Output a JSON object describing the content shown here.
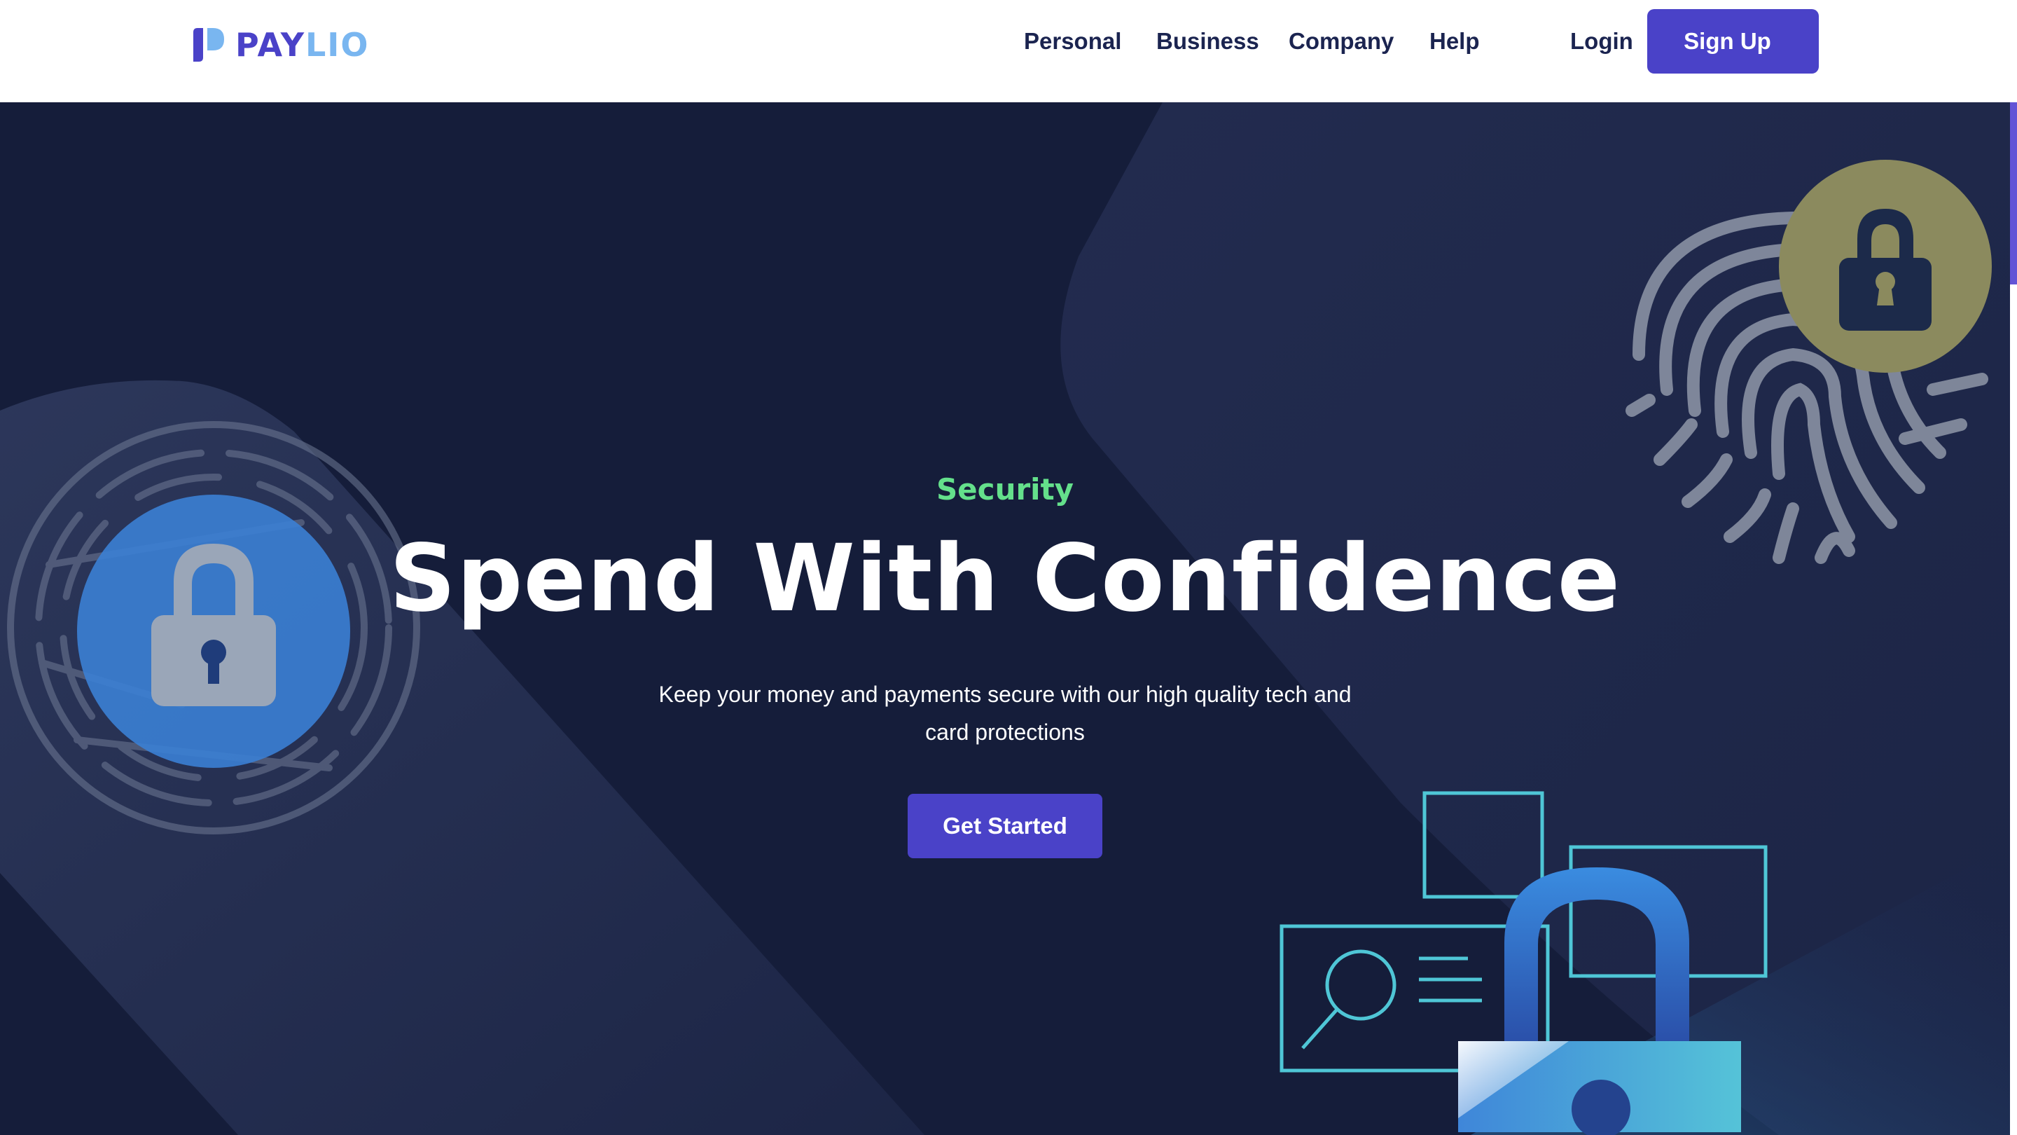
{
  "brand": {
    "logo_part1": "PAY",
    "logo_part2": "LIO",
    "accent_color": "#4a42c8",
    "accent_light": "#79b6f0"
  },
  "nav": {
    "items": [
      {
        "label": "Personal"
      },
      {
        "label": "Business"
      },
      {
        "label": "Company"
      },
      {
        "label": "Help"
      }
    ],
    "login_label": "Login",
    "signup_label": "Sign Up"
  },
  "hero": {
    "eyebrow": "Security",
    "headline": "Spend With Confidence",
    "subtext": "Keep your money and payments secure with our high quality tech and card protections",
    "cta_label": "Get Started",
    "eyebrow_color": "#64e08b",
    "background_color": "#151d3a"
  },
  "icons": {
    "left": "lock-circle-icon",
    "top_right": "fingerprint-lock-icon",
    "bottom_right": "padlock-document-icon"
  }
}
